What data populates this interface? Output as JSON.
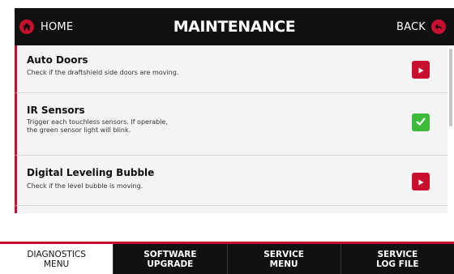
{
  "header": {
    "home_label": "HOME",
    "title": "MAINTENANCE",
    "back_label": "BACK"
  },
  "items": [
    {
      "title": "Auto Doors",
      "desc_lines": [
        "Check if the draftshield side doors are moving."
      ],
      "action": "play-icon"
    },
    {
      "title": "IR Sensors",
      "desc_lines": [
        "Trigger each touchless sensors. If operable,",
        "the green sensor light will blink."
      ],
      "action": "check-icon"
    },
    {
      "title": "Digital Leveling Bubble",
      "desc_lines": [
        "Check if the level bubble is moving."
      ],
      "action": "play-icon"
    }
  ],
  "tabs": [
    {
      "line1": "DIAGNOSTICS",
      "line2": "MENU",
      "active": true
    },
    {
      "line1": "SOFTWARE",
      "line2": "UPGRADE",
      "active": false
    },
    {
      "line1": "SERVICE",
      "line2": "MENU",
      "active": false
    },
    {
      "line1": "SERVICE",
      "line2": "LOG FILE",
      "active": false
    }
  ],
  "colors": {
    "accent": "#c8102e",
    "header_bg": "#111111",
    "success": "#3cba3a",
    "list_bg": "#f4f4f4"
  }
}
